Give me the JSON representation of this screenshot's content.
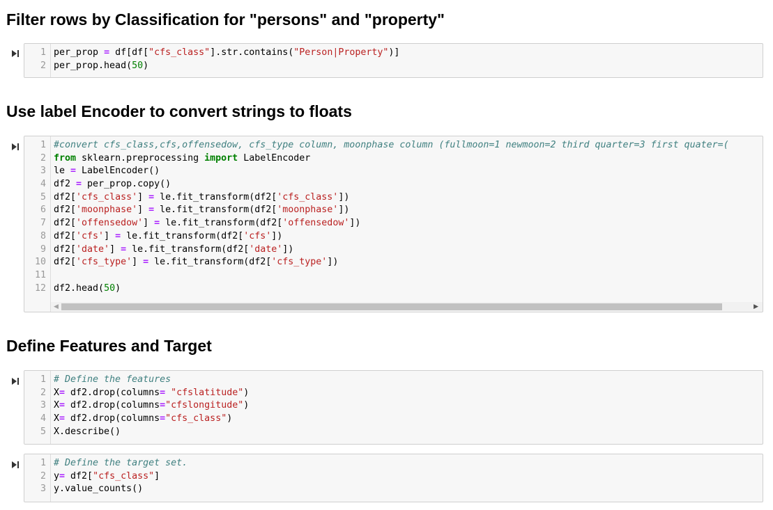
{
  "headings": {
    "filter": "Filter rows by Classification for \"persons\" and \"property\"",
    "encoder": "Use label Encoder to convert strings to floats",
    "features": "Define Features and Target"
  },
  "icons": {
    "run": "run-cell-icon",
    "scroll_left": "scroll-left-arrow-icon",
    "scroll_right": "scroll-right-arrow-icon"
  },
  "colors": {
    "keyword": "#008000",
    "operator": "#aa22ff",
    "string": "#ba2121",
    "comment": "#408080",
    "number": "#008000"
  },
  "cells": [
    {
      "line_numbers": [
        "1",
        "2"
      ],
      "lines": [
        [
          [
            "per_prop ",
            ""
          ],
          [
            "=",
            "op"
          ],
          [
            " df[df[",
            ""
          ],
          [
            "\"cfs_class\"",
            "st"
          ],
          [
            "].str.contains(",
            ""
          ],
          [
            "\"Person|Property\"",
            "st"
          ],
          [
            ")]",
            ""
          ]
        ],
        [
          [
            "per_prop.head(",
            ""
          ],
          [
            "50",
            "nm"
          ],
          [
            ")",
            ""
          ]
        ]
      ]
    },
    {
      "line_numbers": [
        "1",
        "2",
        "3",
        "4",
        "5",
        "6",
        "7",
        "8",
        "9",
        "10",
        "11",
        "12"
      ],
      "lines": [
        [
          [
            "#convert cfs_class,cfs,offensedow, cfs_type column, moonphase column (fullmoon=1 newmoon=2 third quarter=3 first quater=(",
            "cm"
          ]
        ],
        [
          [
            "from",
            "kw"
          ],
          [
            " sklearn.preprocessing ",
            ""
          ],
          [
            "import",
            "kw"
          ],
          [
            " LabelEncoder",
            ""
          ]
        ],
        [
          [
            "le ",
            ""
          ],
          [
            "=",
            "op"
          ],
          [
            " LabelEncoder()",
            ""
          ]
        ],
        [
          [
            "df2 ",
            ""
          ],
          [
            "=",
            "op"
          ],
          [
            " per_prop.copy()",
            ""
          ]
        ],
        [
          [
            "df2[",
            ""
          ],
          [
            "'cfs_class'",
            "st"
          ],
          [
            "] ",
            ""
          ],
          [
            "=",
            "op"
          ],
          [
            " le.fit_transform(df2[",
            ""
          ],
          [
            "'cfs_class'",
            "st"
          ],
          [
            "])",
            ""
          ]
        ],
        [
          [
            "df2[",
            ""
          ],
          [
            "'moonphase'",
            "st"
          ],
          [
            "] ",
            ""
          ],
          [
            "=",
            "op"
          ],
          [
            " le.fit_transform(df2[",
            ""
          ],
          [
            "'moonphase'",
            "st"
          ],
          [
            "])",
            ""
          ]
        ],
        [
          [
            "df2[",
            ""
          ],
          [
            "'offensedow'",
            "st"
          ],
          [
            "] ",
            ""
          ],
          [
            "=",
            "op"
          ],
          [
            " le.fit_transform(df2[",
            ""
          ],
          [
            "'offensedow'",
            "st"
          ],
          [
            "])",
            ""
          ]
        ],
        [
          [
            "df2[",
            ""
          ],
          [
            "'cfs'",
            "st"
          ],
          [
            "] ",
            ""
          ],
          [
            "=",
            "op"
          ],
          [
            " le.fit_transform(df2[",
            ""
          ],
          [
            "'cfs'",
            "st"
          ],
          [
            "])",
            ""
          ]
        ],
        [
          [
            "df2[",
            ""
          ],
          [
            "'date'",
            "st"
          ],
          [
            "] ",
            ""
          ],
          [
            "=",
            "op"
          ],
          [
            " le.fit_transform(df2[",
            ""
          ],
          [
            "'date'",
            "st"
          ],
          [
            "])",
            ""
          ]
        ],
        [
          [
            "df2[",
            ""
          ],
          [
            "'cfs_type'",
            "st"
          ],
          [
            "] ",
            ""
          ],
          [
            "=",
            "op"
          ],
          [
            " le.fit_transform(df2[",
            ""
          ],
          [
            "'cfs_type'",
            "st"
          ],
          [
            "])",
            ""
          ]
        ],
        [],
        [
          [
            "df2.head(",
            ""
          ],
          [
            "50",
            "nm"
          ],
          [
            ")",
            ""
          ]
        ]
      ]
    },
    {
      "line_numbers": [
        "1",
        "2",
        "3",
        "4",
        "5"
      ],
      "lines": [
        [
          [
            "# Define the features",
            "cm"
          ]
        ],
        [
          [
            "X",
            ""
          ],
          [
            "=",
            "op"
          ],
          [
            " df2.drop(columns",
            ""
          ],
          [
            "=",
            "op"
          ],
          [
            " ",
            ""
          ],
          [
            "\"cfslatitude\"",
            "st"
          ],
          [
            ")",
            ""
          ]
        ],
        [
          [
            "X",
            ""
          ],
          [
            "=",
            "op"
          ],
          [
            " df2.drop(columns",
            ""
          ],
          [
            "=",
            "op"
          ],
          [
            "\"cfslongitude\"",
            "st"
          ],
          [
            ")",
            ""
          ]
        ],
        [
          [
            "X",
            ""
          ],
          [
            "=",
            "op"
          ],
          [
            " df2.drop(columns",
            ""
          ],
          [
            "=",
            "op"
          ],
          [
            "\"cfs_class\"",
            "st"
          ],
          [
            ")",
            ""
          ]
        ],
        [
          [
            "X.describe()",
            ""
          ]
        ]
      ]
    },
    {
      "line_numbers": [
        "1",
        "2",
        "3"
      ],
      "lines": [
        [
          [
            "# Define the target set.",
            "cm"
          ]
        ],
        [
          [
            "y",
            ""
          ],
          [
            "=",
            "op"
          ],
          [
            " df2[",
            ""
          ],
          [
            "\"cfs_class\"",
            "st"
          ],
          [
            "]",
            ""
          ]
        ],
        [
          [
            "y.value_counts()",
            ""
          ]
        ]
      ]
    }
  ]
}
